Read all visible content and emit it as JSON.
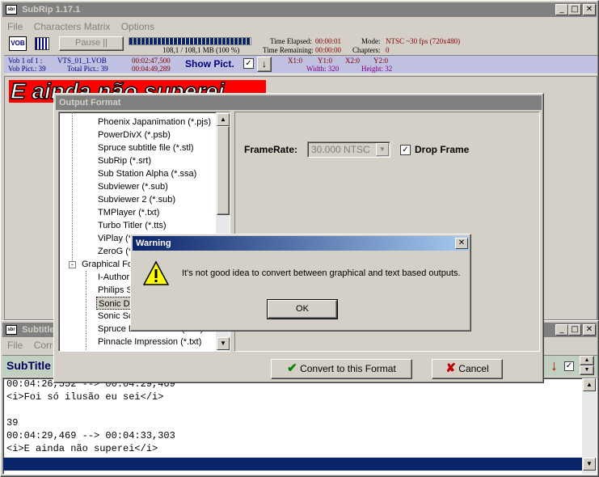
{
  "main_window": {
    "title": "SubRip 1.17.1",
    "menu": [
      "File",
      "Characters Matrix",
      "Options"
    ],
    "pause_label": "Pause ||",
    "progress_text": "108,1 / 108,1 MB (100 %)",
    "time_elapsed_label": "Time Elapsed:",
    "time_elapsed": "00:00:01",
    "time_remaining_label": "Time Remaining:",
    "time_remaining": "00:00:00",
    "mode_label": "Mode:",
    "mode": "NTSC ~30 fps (720x480)",
    "chapters_label": "Chapters:",
    "chapters": "0",
    "vob_line1": "Vob 1 of 1 :",
    "vts": "VTS_01_1.VOB",
    "vob_time1": "00:02:47,500",
    "vob_line2": "Vob Pict.: 39",
    "total_pict": "Total Pict.: 39",
    "vob_time2": "00:04:49,289",
    "show_pict": "Show Pict.",
    "x1": "X1:0",
    "y1": "Y1:0",
    "x2": "X2:0",
    "y2": "Y2:0",
    "width": "Width: 320",
    "height": "Height: 32",
    "subtitle_image_text": "E ainda não superei"
  },
  "subtitles_window": {
    "title": "Subtitles",
    "menu": [
      "File",
      "Correct"
    ],
    "subtitle_label": "SubTitle",
    "lines": [
      "00:04:26,552 --> 00:04:29,469",
      "<i>Foi só ilusão eu sei</i>",
      "",
      "39",
      "00:04:29,469 --> 00:04:33,303",
      "<i>E ainda não superei</i>"
    ]
  },
  "output_format": {
    "title": "Output Format",
    "formats": [
      "Phoenix Japanimation (*.pjs)",
      "PowerDivX (*.psb)",
      "Spruce subtitle file (*.stl)",
      "SubRip (*.srt)",
      "Sub Station Alpha (*.ssa)",
      "Subviewer (*.sub)",
      "Subviewer 2 (*.sub)",
      "TMPlayer (*.txt)",
      "Turbo Titler (*.tts)",
      "ViPlay (*.vsf)",
      "ZeroG (*.zeg)"
    ],
    "graphical_group": "Graphical Formats",
    "graphical_formats": [
      "I-Author (*.txt)",
      "Philips SVCD",
      "Sonic DVD",
      "Sonic Scenarist",
      "Spruce DVDMaestro (*.txt)",
      "Pinnacle Impression (*.txt)"
    ],
    "framerate_label": "FrameRate:",
    "framerate_value": "30.000 NTSC",
    "drop_frame_label": "Drop Frame",
    "convert_label": "Convert to this Format",
    "cancel_label": "Cancel"
  },
  "warning": {
    "title": "Warning",
    "message": "It's not good idea to convert between graphical and text based outputs.",
    "ok_label": "OK"
  }
}
